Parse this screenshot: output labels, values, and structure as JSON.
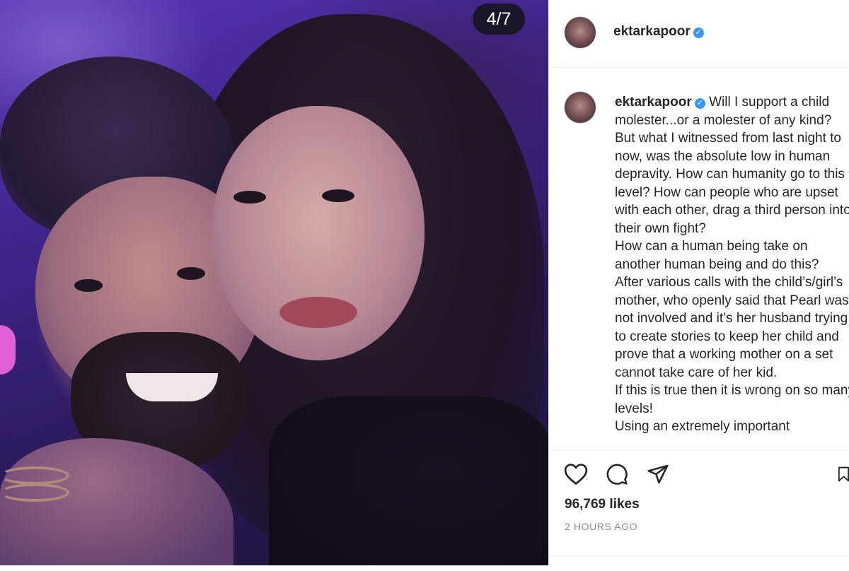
{
  "post": {
    "image_counter": "4/7",
    "username": "ektarkapoor",
    "caption_text": "Will I support a child molester...or a molester of any kind? But what I witnessed from last night to now, was the absolute low in human depravity. How can humanity go to this level? How can people who are upset with each other, drag a third person into their own fight?\nHow can a human being take on another human being and do this?\nAfter various calls with the child’s/girl’s mother, who openly said that Pearl was not involved and it’s her husband trying to create stories to keep her child and prove that a working mother on a set cannot take care of her kid.\nIf this is true then it is wrong on so many levels!\nUsing an extremely important",
    "likes": "96,769 likes",
    "timestamp": "2 HOURS AGO"
  },
  "icons": {
    "like": "heart-icon",
    "comment": "comment-icon",
    "share": "paper-plane-icon",
    "save": "bookmark-icon",
    "verified": "verified-badge-icon"
  },
  "colors": {
    "verified": "#3897f0",
    "text": "#262626",
    "muted": "#8e8e8e"
  }
}
